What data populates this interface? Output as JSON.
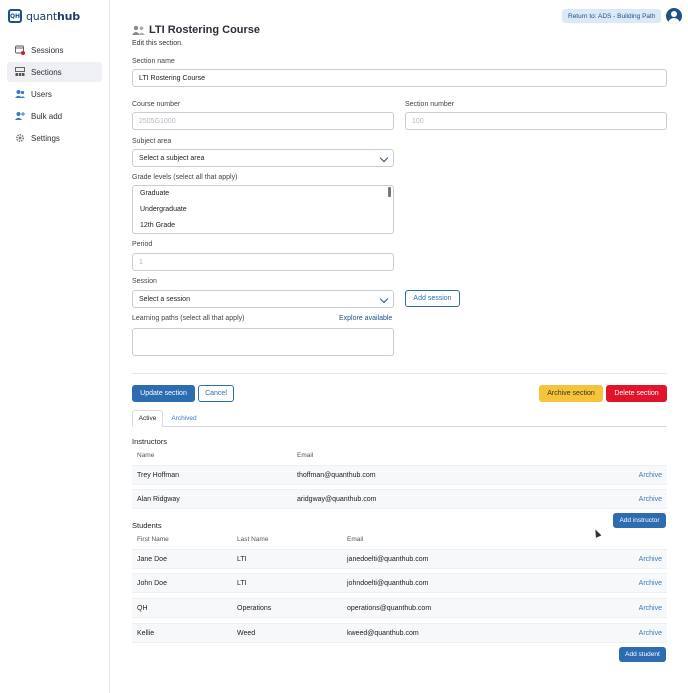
{
  "app": {
    "logo_text_light": "quant",
    "logo_text_bold": "hub",
    "logo_mark": "QH"
  },
  "sidebar": {
    "items": [
      {
        "label": "Sessions",
        "icon": "sessions-icon",
        "active": false
      },
      {
        "label": "Sections",
        "icon": "sections-icon",
        "active": true
      },
      {
        "label": "Users",
        "icon": "users-icon",
        "active": false
      },
      {
        "label": "Bulk add",
        "icon": "bulk-add-icon",
        "active": false
      },
      {
        "label": "Settings",
        "icon": "gear-icon",
        "active": false
      }
    ]
  },
  "header": {
    "return_label": "Return to: ADS - Building Path"
  },
  "page": {
    "title": "LTI Rostering Course",
    "subtitle": "Edit this section."
  },
  "form": {
    "section_name_label": "Section name",
    "section_name_value": "LTI Rostering Course",
    "course_number_label": "Course number",
    "course_number_value": "2505G1000",
    "section_number_label": "Section number",
    "section_number_value": "100",
    "subject_area_label": "Subject area",
    "subject_area_value": "Select a subject area",
    "grade_levels_label": "Grade levels (select all that apply)",
    "grade_levels_options": [
      "Graduate",
      "Undergraduate",
      "12th Grade"
    ],
    "period_label": "Period",
    "period_value": "1",
    "session_label": "Session",
    "session_value": "Select a session",
    "add_session_label": "Add session",
    "learning_paths_label": "Learning paths (select all that apply)",
    "explore_label": "Explore available"
  },
  "actions": {
    "update_label": "Update section",
    "cancel_label": "Cancel",
    "archive_label": "Archive section",
    "delete_label": "Delete section"
  },
  "tabs": {
    "active": "Active",
    "archived": "Archived"
  },
  "instructors": {
    "title": "Instructors",
    "columns": [
      "Name",
      "Email"
    ],
    "rows": [
      {
        "name": "Trey Hoffman",
        "email": "thoffman@quanthub.com",
        "action": "Archive"
      },
      {
        "name": "Alan Ridgway",
        "email": "aridgway@quanthub.com",
        "action": "Archive"
      }
    ],
    "add_label": "Add instructor"
  },
  "students": {
    "title": "Students",
    "columns": [
      "First Name",
      "Last Name",
      "Email"
    ],
    "rows": [
      {
        "first": "Jane Doe",
        "last": "LTI",
        "email": "janedoelti@quanthub.com",
        "action": "Archive"
      },
      {
        "first": "John Doe",
        "last": "LTI",
        "email": "johndoelti@quanthub.com",
        "action": "Archive"
      },
      {
        "first": "QH",
        "last": "Operations",
        "email": "operations@quanthub.com",
        "action": "Archive"
      },
      {
        "first": "Kellie",
        "last": "Weed",
        "email": "kweed@quanthub.com",
        "action": "Archive"
      }
    ],
    "add_label": "Add student"
  },
  "colors": {
    "primary": "#2d6cb0",
    "brand": "#1f4f87",
    "warn": "#f6c43a",
    "danger": "#e0152c",
    "link": "#3a7bc0"
  }
}
